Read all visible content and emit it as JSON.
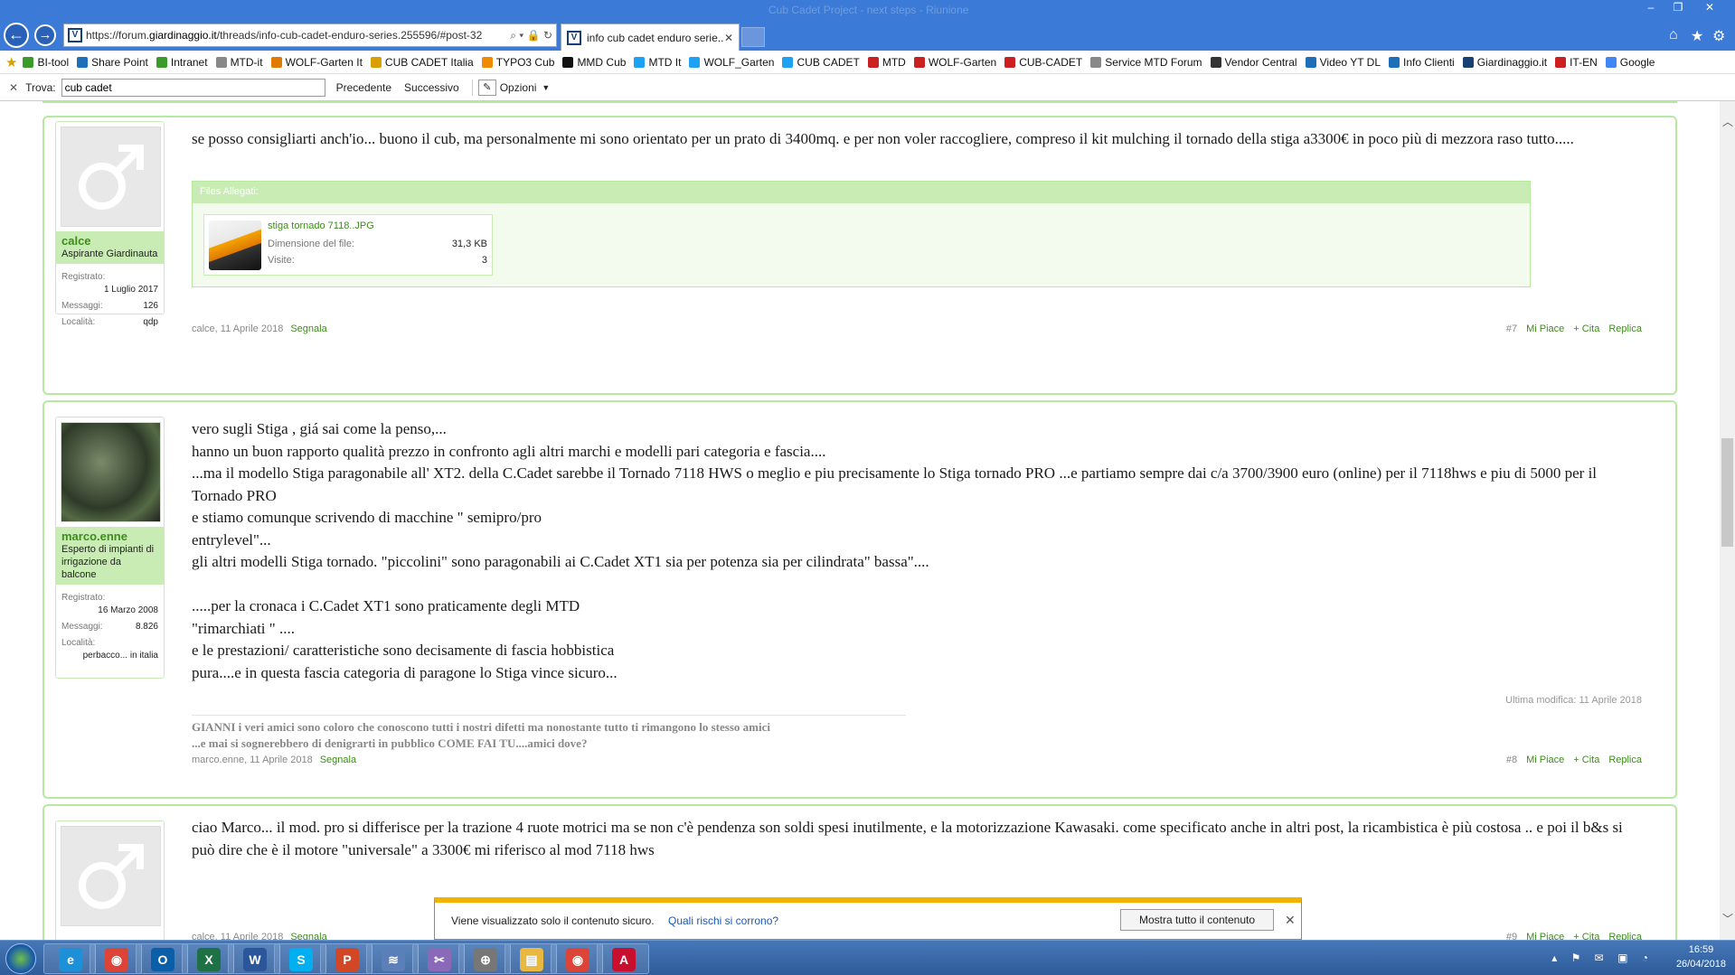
{
  "titlebar": {
    "ghost_text": "Cub Cadet Project - next steps - Riunione",
    "minimize": "–",
    "restore": "❐",
    "close": "✕"
  },
  "browser": {
    "url_prefix": "https://forum.",
    "url_domain": "giardinaggio.it",
    "url_rest": "/threads/info-cub-cadet-enduro-series.255596/#post-32",
    "url_icons": "⌕ ▾ 🔒 ↻",
    "tab_title": "info cub cadet enduro serie...",
    "tab_close": "✕",
    "home": "⌂",
    "star": "★",
    "gear": "⚙"
  },
  "favorites": [
    {
      "label": "BI-tool",
      "color": "#3a9a2a"
    },
    {
      "label": "Share Point",
      "color": "#1c6fb8"
    },
    {
      "label": "Intranet",
      "color": "#3a9a2a"
    },
    {
      "label": "MTD-it",
      "color": "#888888"
    },
    {
      "label": "WOLF-Garten It",
      "color": "#e07a00"
    },
    {
      "label": "CUB CADET Italia",
      "color": "#d8a000"
    },
    {
      "label": "TYPO3 Cub",
      "color": "#f08a00"
    },
    {
      "label": "MMD Cub",
      "color": "#111111"
    },
    {
      "label": "MTD It",
      "color": "#1da1f2"
    },
    {
      "label": "WOLF_Garten",
      "color": "#1da1f2"
    },
    {
      "label": "CUB CADET",
      "color": "#1da1f2"
    },
    {
      "label": "MTD",
      "color": "#cc1f1f"
    },
    {
      "label": "WOLF-Garten",
      "color": "#cc1f1f"
    },
    {
      "label": "CUB-CADET",
      "color": "#cc1f1f"
    },
    {
      "label": "Service MTD Forum",
      "color": "#888888"
    },
    {
      "label": "Vendor Central",
      "color": "#333333"
    },
    {
      "label": "Video YT DL",
      "color": "#1c6fb8"
    },
    {
      "label": "Info Clienti",
      "color": "#1c6fb8"
    },
    {
      "label": "Giardinaggio.it",
      "color": "#163f73"
    },
    {
      "label": "IT-EN",
      "color": "#cc1f1f"
    },
    {
      "label": "Google",
      "color": "#4285f4"
    }
  ],
  "findbar": {
    "close": "✕",
    "label": "Trova:",
    "value": "cub cadet",
    "prev": "Precedente",
    "next": "Successivo",
    "options": "Opzioni"
  },
  "posts": [
    {
      "username": "calce",
      "usertitle": "Aspirante Giardinauta",
      "stats": [
        {
          "k": "Registrato:",
          "v": "1 Luglio 2017"
        },
        {
          "k": "Messaggi:",
          "v": "126"
        },
        {
          "k": "Località:",
          "v": "qdp"
        }
      ],
      "message": [
        "se posso consigliarti anch'io... buono il cub, ma personalmente mi sono orientato per un prato di 3400mq. e per non voler raccogliere, compreso il kit mulching il tornado della stiga a3300€ in poco più di mezzora raso tutto....."
      ],
      "attach": {
        "header": "Files Allegati:",
        "filename": "stiga tornado 7118..JPG",
        "size_label": "Dimensione del file:",
        "size": "31,3 KB",
        "views_label": "Visite:",
        "views": "3"
      },
      "meta": "calce, 11 Aprile 2018",
      "report": "Segnala",
      "num": "#7",
      "like": "Mi Piace",
      "quote": "+ Cita",
      "reply": "Replica"
    },
    {
      "username": "marco.enne",
      "usertitle": "Esperto di impianti di irrigazione da balcone",
      "stats": [
        {
          "k": "Registrato:",
          "v": "16 Marzo 2008"
        },
        {
          "k": "Messaggi:",
          "v": "8.826"
        },
        {
          "k": "Località:",
          "v": "perbacco... in italia"
        }
      ],
      "message": [
        "vero sugli Stiga , giá sai come la penso,...",
        "hanno un buon rapporto qualità prezzo in confronto agli altri marchi e modelli pari categoria e fascia....",
        "...ma il modello Stiga paragonabile all' XT2. della C.Cadet sarebbe il Tornado 7118 HWS o meglio e piu precisamente lo Stiga tornado PRO ...e partiamo sempre dai c/a 3700/3900 euro (online) per il 7118hws e piu di 5000 per il Tornado PRO",
        "e stiamo comunque scrivendo di macchine \" semipro/pro",
        "entrylevel\"...",
        "gli altri modelli Stiga tornado. \"piccolini\" sono paragonabili ai C.Cadet XT1 sia per potenza sia per cilindrata\" bassa\"....",
        "",
        ".....per la cronaca i C.Cadet XT1 sono praticamente degli MTD",
        "\"rimarchiati \" ....",
        "e le prestazioni/ caratteristiche sono decisamente di fascia hobbistica",
        "pura....e in questa fascia categoria di paragone lo Stiga vince sicuro..."
      ],
      "edited": "Ultima modifica: 11 Aprile 2018",
      "signature": [
        "GIANNI i veri amici sono coloro che conoscono tutti i nostri difetti ma nonostante tutto ti rimangono lo stesso amici",
        "...e mai si sognerebbero di denigrarti in pubblico COME FAI TU....amici dove?"
      ],
      "meta": "marco.enne, 11 Aprile 2018",
      "report": "Segnala",
      "num": "#8",
      "like": "Mi Piace",
      "quote": "+ Cita",
      "reply": "Replica"
    },
    {
      "username": "calce",
      "message": [
        "ciao Marco... il mod. pro si differisce per la trazione 4 ruote motrici ma se non c'è pendenza son soldi spesi inutilmente, e la motorizzazione Kawasaki. come specificato anche in altri post, la ricambistica è più costosa .. e poi il b&s si può dire che è il motore \"universale\" a 3300€ mi riferisco al mod 7118 hws"
      ],
      "meta": "calce, 11 Aprile 2018",
      "report": "Segnala",
      "num": "#9",
      "like": "Mi Piace",
      "quote": "+ Cita",
      "reply": "Replica"
    }
  ],
  "notification": {
    "text": "Viene visualizzato solo il contenuto sicuro.",
    "link": "Quali rischi si corrono?",
    "button": "Mostra tutto il contenuto",
    "close": "✕"
  },
  "taskbar": {
    "apps": [
      {
        "name": "internet-explorer",
        "glyph": "e",
        "color": "#1e90d8"
      },
      {
        "name": "chrome",
        "glyph": "◉",
        "color": "#db4437"
      },
      {
        "name": "outlook",
        "glyph": "O",
        "color": "#0a5fa8"
      },
      {
        "name": "excel",
        "glyph": "X",
        "color": "#1e7145"
      },
      {
        "name": "word",
        "glyph": "W",
        "color": "#2b579a"
      },
      {
        "name": "skype",
        "glyph": "S",
        "color": "#00aff0"
      },
      {
        "name": "powerpoint",
        "glyph": "P",
        "color": "#d24726"
      },
      {
        "name": "rss",
        "glyph": "≋",
        "color": "#5b7fb8"
      },
      {
        "name": "snipping-tool",
        "glyph": "✂",
        "color": "#8a6ab8"
      },
      {
        "name": "network-tool",
        "glyph": "⊕",
        "color": "#777777"
      },
      {
        "name": "file-explorer",
        "glyph": "▤",
        "color": "#e8b840"
      },
      {
        "name": "chrome-app",
        "glyph": "◉",
        "color": "#db4437"
      },
      {
        "name": "acrobat",
        "glyph": "A",
        "color": "#c8102e"
      }
    ],
    "tray_icons": "▴ ⚑ ✉ ▣ ◔",
    "time": "16:59",
    "date": "26/04/2018"
  }
}
